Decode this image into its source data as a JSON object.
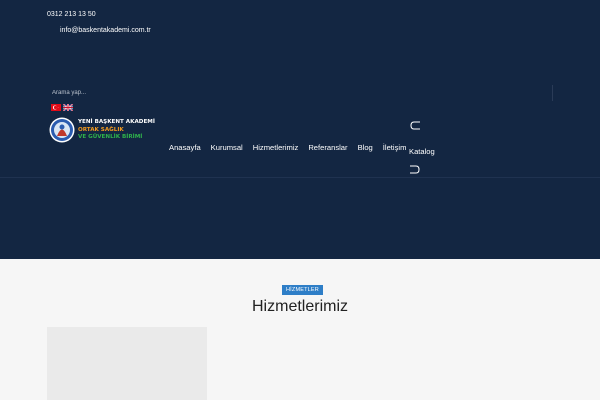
{
  "topbar": {
    "phone": "0312 213 13 50",
    "email": "info@baskentakademi.com.tr"
  },
  "search": {
    "placeholder": "Arama yap..."
  },
  "languages": [
    "Türkçe",
    "English"
  ],
  "brand": {
    "line1": "YENİ BAŞKENT AKADEMİ",
    "line2": "ORTAK SAĞLIK",
    "line3": "VE GÜVENLİK BİRİMİ"
  },
  "nav": {
    "items": [
      {
        "label": "Anasayfa"
      },
      {
        "label": "Kurumsal"
      },
      {
        "label": "Hizmetlerimiz"
      },
      {
        "label": "Referanslar"
      },
      {
        "label": "Blog"
      },
      {
        "label": "İletişim"
      }
    ],
    "catalog": "Katalog"
  },
  "section": {
    "badge": "HİZMETLER",
    "title": "Hizmetlerimiz"
  },
  "colors": {
    "hero_bg": "#132642",
    "accent": "#2e7ec7",
    "brand_orange": "#f39a1f",
    "brand_green": "#2fb24b",
    "page_bg": "#f6f6f6"
  },
  "icons": {
    "flag_tr": "turkish-flag-icon",
    "flag_en": "uk-flag-icon",
    "logo": "academy-logo-icon",
    "catalog_top": "bracket-top-icon",
    "catalog_bottom": "bracket-bottom-icon"
  }
}
